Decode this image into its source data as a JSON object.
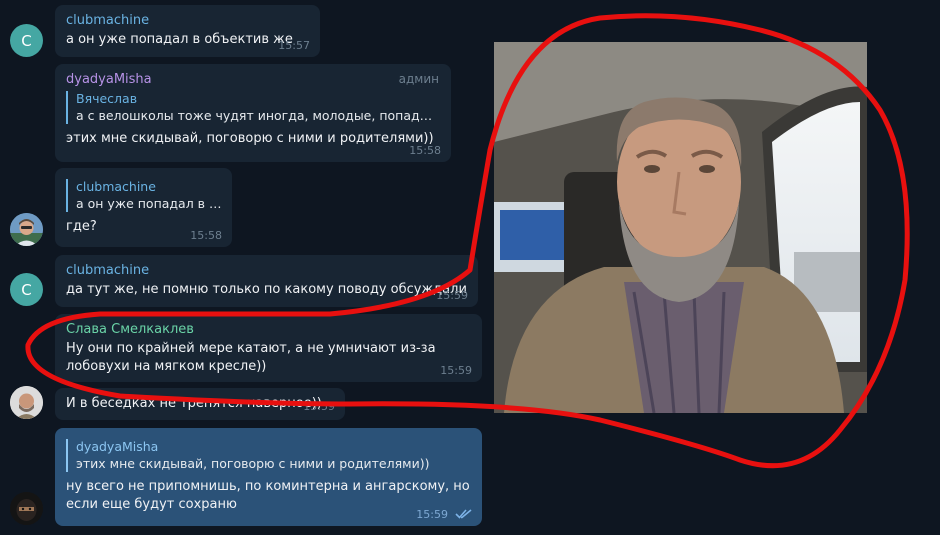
{
  "messages": [
    {
      "sender": "clubmachine",
      "avatar_letter": "C",
      "text": "а он уже попадал в объектив же",
      "time": "15:57"
    },
    {
      "sender": "dyadyaMisha",
      "badge": "админ",
      "reply_name": "Вячеслав",
      "reply_text": "а с велошколы тоже чудят иногда, молодые, попадаютс...",
      "text": "этих мне скидывай, поговорю с ними и родителями))",
      "time": "15:58"
    },
    {
      "reply_name": "clubmachine",
      "reply_text": "а он уже попадал в о...",
      "text": "где?",
      "time": "15:58"
    },
    {
      "sender": "clubmachine",
      "avatar_letter": "C",
      "text": "да тут же, не помню только по какому поводу обсуждали",
      "time": "15:59"
    },
    {
      "sender": "Слава Смелкаклев",
      "text": "Ну они по крайней мере катают, а не умничают из-за лобовухи на мягком кресле))",
      "time": "15:59"
    },
    {
      "text": "И в беседках не трепятся наверное))",
      "time": "15:59"
    },
    {
      "reply_name": "dyadyaMisha",
      "reply_text": "этих мне скидывай, поговорю с ними и родителями))",
      "text": "ну всего не припомнишь, по коминтерна и ангарскому, но если еще будут сохраню",
      "time": "15:59",
      "status": "read"
    }
  ],
  "colors": {
    "background": "#0e1621",
    "bubble_in": "#182533",
    "bubble_out": "#2b5278",
    "annotation": "#e8100f"
  }
}
